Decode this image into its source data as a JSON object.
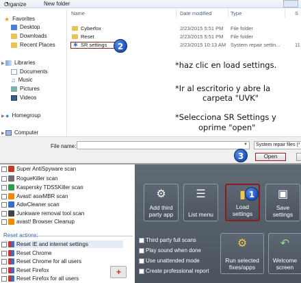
{
  "toolbar": {
    "organize": "Organize",
    "new_folder": "New folder"
  },
  "nav": {
    "favorites": "Favorites",
    "desktop": "Desktop",
    "downloads": "Downloads",
    "recent_places": "Recent Places",
    "libraries": "Libraries",
    "documents": "Documents",
    "music": "Music",
    "pictures": "Pictures",
    "videos": "Videos",
    "homegroup": "Homegroup",
    "computer": "Computer"
  },
  "columns": {
    "name": "Name",
    "date_modified": "Date modified",
    "type": "Type",
    "size": "S"
  },
  "files": [
    {
      "name": "Cyberfox",
      "date": "2/23/2015 5:51 PM",
      "type": "File folder",
      "size": ""
    },
    {
      "name": "Reset",
      "date": "2/23/2015 5:51 PM",
      "type": "File folder",
      "size": ""
    },
    {
      "name": "SR settings",
      "date": "2/23/2015 10:13 AM",
      "type": "System repair settin...",
      "size": "11"
    }
  ],
  "instructions": {
    "line1": "*haz clic en load settings.",
    "line2": "*Ir  al escritorio y abre la",
    "line3": "carpeta \"UVK\"",
    "line4": "*Selecciona SR Settings y",
    "line5": "oprime \"open\""
  },
  "badges": {
    "one": "1",
    "two": "2",
    "three": "3"
  },
  "dialog": {
    "file_name_label": "File name:",
    "file_name_value": "",
    "file_type": "System repair files (*",
    "open": "Open"
  },
  "scans": [
    {
      "label": "Super AntiSpyware scan",
      "color": "#c23b22"
    },
    {
      "label": "RogueKiller scan",
      "color": "#6e6e6e"
    },
    {
      "label": "Kaspersky TDSSKiller scan",
      "color": "#2e9c4a"
    },
    {
      "label": "Avast! aswMBR scan",
      "color": "#f08a00"
    },
    {
      "label": "AdwCleaner scan",
      "color": "#3a6fc4"
    },
    {
      "label": "Junkware removal tool scan",
      "color": "#444444"
    },
    {
      "label": "avast! Browser Cleanup",
      "color": "#f08a00"
    }
  ],
  "reset_actions": {
    "header": "Reset actions:",
    "items": [
      "Reset IE and internet settings",
      "Reset Chrome",
      "Reset Chrome for all users",
      "Reset Firefox",
      "Reset Firefox for all users"
    ]
  },
  "tiles": {
    "add_third": "Add third party app",
    "list_menu": "List menu",
    "load_settings": "Load settings",
    "save_settings": "Save settings",
    "run_selected": "Run selected fixes/apps",
    "welcome": "Welcome screen"
  },
  "options": [
    "Third party full scans",
    "Play sound when done",
    "Use unattended mode",
    "Create professional report"
  ]
}
